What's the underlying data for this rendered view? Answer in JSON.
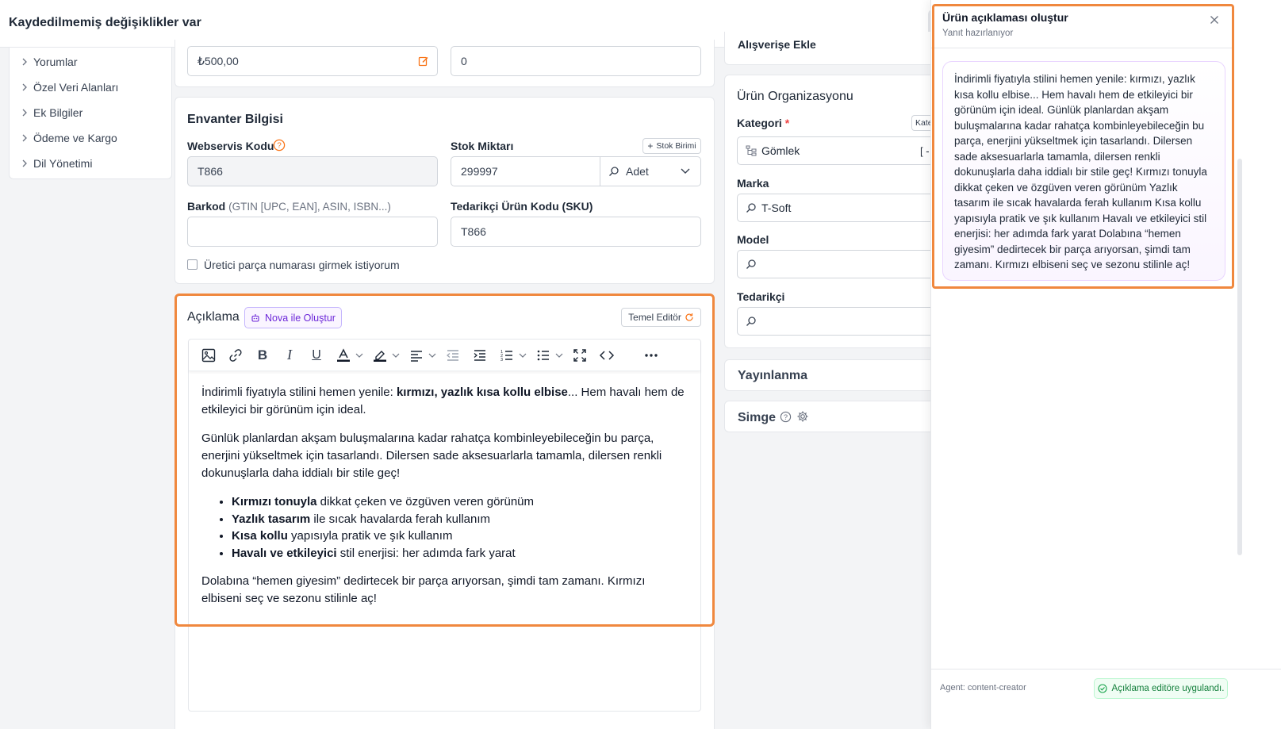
{
  "header": {
    "title": "Kaydedilmemiş değişiklikler var"
  },
  "sidebar": {
    "items": [
      {
        "label": "Yorumlar"
      },
      {
        "label": "Özel Veri Alanları"
      },
      {
        "label": "Ek Bilgiler"
      },
      {
        "label": "Ödeme ve Kargo"
      },
      {
        "label": "Dil Yönetimi"
      }
    ]
  },
  "pricing": {
    "price_value": "₺500,00",
    "second_value": "0"
  },
  "inventory": {
    "title": "Envanter Bilgisi",
    "webservice_label": "Webservis Kodu",
    "webservice_value": "T866",
    "stock_label": "Stok Miktarı",
    "stock_unit_button": "Stok Birimi",
    "stock_value": "299997",
    "stock_unit_value": "Adet",
    "barcode_label": "Barkod",
    "barcode_hint": "(GTIN [UPC, EAN], ASIN, ISBN...)",
    "barcode_value": "",
    "sku_label": "Tedarikçi Ürün Kodu (SKU)",
    "sku_value": "T866",
    "manufacturer_checkbox_label": "Üretici parça numarası girmek istiyorum"
  },
  "description": {
    "title": "Açıklama",
    "nova_button": "Nova ile Oluştur",
    "basic_editor_button": "Temel Editör",
    "content": {
      "p1_start": "İndirimli fiyatıyla stilini hemen yenile: ",
      "p1_bold": "kırmızı, yazlık kısa kollu elbise",
      "p1_end": "... Hem havalı hem de etkileyici bir görünüm için ideal.",
      "p2": "Günlük planlardan akşam buluşmalarına kadar rahatça kombinleyebileceğin bu parça, enerjini yükseltmek için tasarlandı. Dilersen sade aksesuarlarla tamamla, dilersen renkli dokunuşlarla daha iddialı bir stile geç!",
      "bullets": [
        {
          "bold": "Kırmızı tonuyla",
          "rest": " dikkat çeken ve özgüven veren görünüm"
        },
        {
          "bold": "Yazlık tasarım",
          "rest": " ile sıcak havalarda ferah kullanım"
        },
        {
          "bold": "Kısa kollu",
          "rest": " yapısıyla pratik ve şık kullanım"
        },
        {
          "bold": "Havalı ve etkileyici",
          "rest": " stil enerjisi: her adımda fark yarat"
        }
      ],
      "p3": "Dolabına “hemen giyesim” dedirtecek bir parça arıyorsan, şimdi tam zamanı. Kırmızı elbiseni seç ve sezonu stilinle aç!"
    }
  },
  "organization": {
    "top_partial_label": "Alışverişe Ekle",
    "title": "Ürün Organizasyonu",
    "category_label": "Kategori",
    "category_required": "*",
    "category_button_partial": "Kate",
    "category_value": "Gömlek",
    "category_trailing": "[ -",
    "brand_label": "Marka",
    "brand_value": "T-Soft",
    "model_label": "Model",
    "supplier_label": "Tedarikçi"
  },
  "publishing": {
    "title": "Yayınlanma"
  },
  "icon_section": {
    "title": "Simge"
  },
  "panel": {
    "title": "Ürün açıklaması oluştur",
    "subtitle": "Yanıt hazırlanıyor",
    "response": "İndirimli fiyatıyla stilini hemen yenile: kırmızı, yazlık kısa kollu elbise... Hem havalı hem de etkileyici bir görünüm için ideal. Günlük planlardan akşam buluşmalarına kadar rahatça kombinleyebileceğin bu parça, enerjini yükseltmek için tasarlandı. Dilersen sade aksesuarlarla tamamla, dilersen renkli dokunuşlarla daha iddialı bir stile geç! Kırmızı tonuyla dikkat çeken ve özgüven veren görünüm Yazlık tasarım ile sıcak havalarda ferah kullanım Kısa kollu yapısıyla pratik ve şık kullanım Havalı ve etkileyici stil enerjisi: her adımda fark yarat Dolabına “hemen giyesim” dedirtecek bir parça arıyorsan, şimdi tam zamanı. Kırmızı elbiseni seç ve sezonu stilinle aç!",
    "agent_label": "Agent: content-creator",
    "applied_badge": "Açıklama editöre uygulandı."
  },
  "colors": {
    "highlight": "#f0883e",
    "accent": "#6d28d9",
    "success": "#15803d",
    "price_edit_icon": "#f97316"
  }
}
